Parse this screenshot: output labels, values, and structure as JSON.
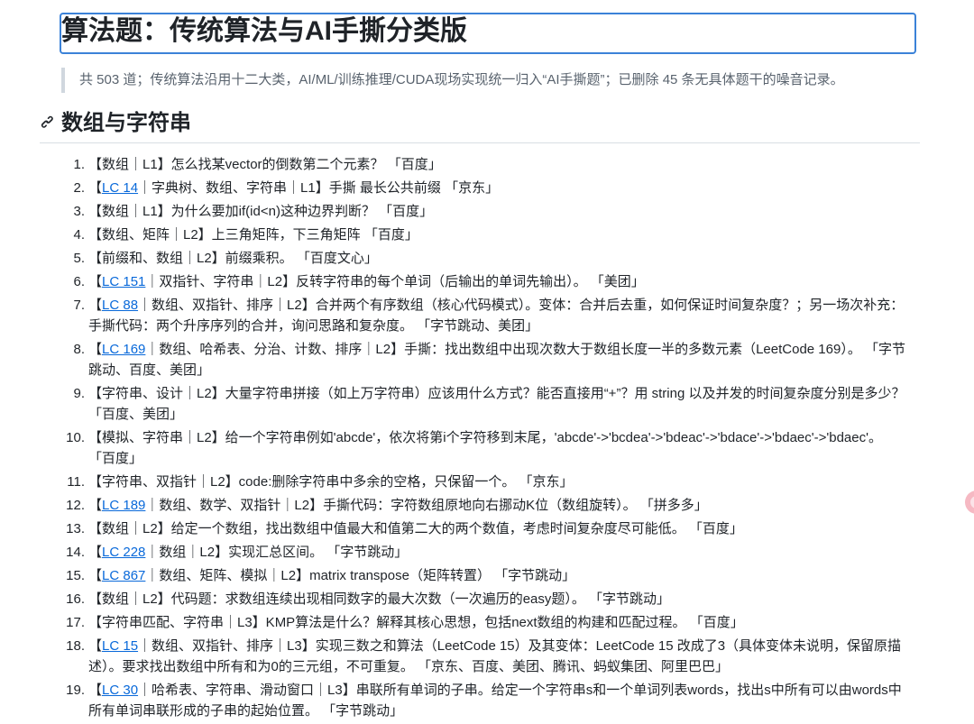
{
  "header": {
    "title": "算法题：传统算法与AI手撕分类版",
    "summary": "共 503 道；传统算法沿用十二大类，AI/ML/训练推理/CUDA现场实现统一归入“AI手撕题”；已删除 45 条无具体题干的噪音记录。"
  },
  "section": {
    "title": "数组与字符串",
    "items": [
      {
        "num": "1.",
        "pre": "【数组｜L1】怎么找某vector的倒数第二个元素？ 「百度」",
        "link": "",
        "post": ""
      },
      {
        "num": "2.",
        "pre": "【",
        "link": "LC 14",
        "post": "｜字典树、数组、字符串｜L1】手撕 最长公共前缀 「京东」"
      },
      {
        "num": "3.",
        "pre": "【数组｜L1】为什么要加if(id<n)这种边界判断？ 「百度」",
        "link": "",
        "post": ""
      },
      {
        "num": "4.",
        "pre": "【数组、矩阵｜L2】上三角矩阵，下三角矩阵 「百度」",
        "link": "",
        "post": ""
      },
      {
        "num": "5.",
        "pre": "【前缀和、数组｜L2】前缀乘积。 「百度文心」",
        "link": "",
        "post": ""
      },
      {
        "num": "6.",
        "pre": "【",
        "link": "LC 151",
        "post": "｜双指针、字符串｜L2】反转字符串的每个单词（后输出的单词先输出）。 「美团」"
      },
      {
        "num": "7.",
        "pre": "【",
        "link": "LC 88",
        "post": "｜数组、双指针、排序｜L2】合并两个有序数组（核心代码模式）。变体：合并后去重，如何保证时间复杂度？；另一场次补充：手撕代码：两个升序序列的合并，询问思路和复杂度。 「字节跳动、美团」"
      },
      {
        "num": "8.",
        "pre": "【",
        "link": "LC 169",
        "post": "｜数组、哈希表、分治、计数、排序｜L2】手撕：找出数组中出现次数大于数组长度一半的多数元素（LeetCode 169）。 「字节跳动、百度、美团」"
      },
      {
        "num": "9.",
        "pre": "【字符串、设计｜L2】大量字符串拼接（如上万字符串）应该用什么方式？能否直接用“+”？用 string 以及并发的时间复杂度分别是多少？ 「百度、美团」",
        "link": "",
        "post": ""
      },
      {
        "num": "10.",
        "pre": "【模拟、字符串｜L2】给一个字符串例如'abcde'，依次将第i个字符移到末尾，'abcde'->'bcdea'->'bdeac'->'bdace'->'bdaec'->'bdaec'。 「百度」",
        "link": "",
        "post": ""
      },
      {
        "num": "11.",
        "pre": "【字符串、双指针｜L2】code:删除字符串中多余的空格，只保留一个。 「京东」",
        "link": "",
        "post": ""
      },
      {
        "num": "12.",
        "pre": "【",
        "link": "LC 189",
        "post": "｜数组、数学、双指针｜L2】手撕代码：字符数组原地向右挪动K位（数组旋转）。 「拼多多」"
      },
      {
        "num": "13.",
        "pre": "【数组｜L2】给定一个数组，找出数组中值最大和值第二大的两个数值，考虑时间复杂度尽可能低。 「百度」",
        "link": "",
        "post": ""
      },
      {
        "num": "14.",
        "pre": "【",
        "link": "LC 228",
        "post": "｜数组｜L2】实现汇总区间。 「字节跳动」"
      },
      {
        "num": "15.",
        "pre": "【",
        "link": "LC 867",
        "post": "｜数组、矩阵、模拟｜L2】matrix transpose（矩阵转置） 「字节跳动」"
      },
      {
        "num": "16.",
        "pre": "【数组｜L2】代码题：求数组连续出现相同数字的最大次数（一次遍历的easy题）。 「字节跳动」",
        "link": "",
        "post": ""
      },
      {
        "num": "17.",
        "pre": "【字符串匹配、字符串｜L3】KMP算法是什么？解释其核心思想，包括next数组的构建和匹配过程。 「百度」",
        "link": "",
        "post": ""
      },
      {
        "num": "18.",
        "pre": "【",
        "link": "LC 15",
        "post": "｜数组、双指针、排序｜L3】实现三数之和算法（LeetCode 15）及其变体：LeetCode 15 改成了3（具体变体未说明，保留原描述）。要求找出数组中所有和为0的三元组，不可重复。 「京东、百度、美团、腾讯、蚂蚁集团、阿里巴巴」"
      },
      {
        "num": "19.",
        "pre": "【",
        "link": "LC 30",
        "post": "｜哈希表、字符串、滑动窗口｜L3】串联所有单词的子串。给定一个字符串s和一个单词列表words，找出s中所有可以由words中所有单词串联形成的子串的起始位置。 「字节跳动」"
      }
    ]
  },
  "colors": {
    "link": "#0969da",
    "title_border": "#3b82d8",
    "quote_bar": "#d0d7de"
  },
  "icons": {
    "anchor": "link-icon"
  }
}
